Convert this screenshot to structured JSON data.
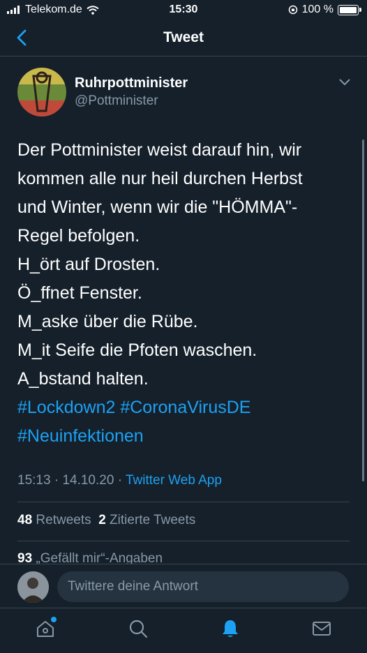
{
  "status_bar": {
    "carrier": "Telekom.de",
    "time": "15:30",
    "battery_percent": "100 %",
    "battery_level": 1.0
  },
  "nav": {
    "title": "Tweet",
    "back_icon": "chevron-left-icon"
  },
  "tweet": {
    "author_name": "Ruhrpottminister",
    "author_handle": "@Pottminister",
    "text_lines": [
      "Der Pottminister weist darauf hin, wir",
      "kommen alle nur heil durchen Herbst",
      "und Winter, wenn wir die \"HÖMMA\"-",
      "Regel befolgen.",
      "H_ört auf Drosten.",
      "Ö_ffnet Fenster.",
      "M_aske über die Rübe.",
      "M_it Seife die Pfoten waschen.",
      "A_bstand halten."
    ],
    "hashtags": [
      "#Lockdown2",
      "#CoronaVirusDE",
      "#Neuinfektionen"
    ],
    "time": "15:13",
    "date": "14.10.20",
    "source": "Twitter Web App"
  },
  "stats": {
    "retweets_count": "48",
    "retweets_label": "Retweets",
    "quotes_count": "2",
    "quotes_label": "Zitierte Tweets",
    "likes_count": "93",
    "likes_label": "„Gefällt mir“-Angaben"
  },
  "reply": {
    "placeholder": "Twittere deine Antwort"
  },
  "tabbar": {
    "items": [
      "home-icon",
      "search-icon",
      "notifications-icon",
      "messages-icon"
    ],
    "active": "notifications-icon"
  },
  "colors": {
    "background": "#15202b",
    "accent": "#1da1f2",
    "secondary_text": "#8899a6",
    "divider": "#38444d"
  }
}
